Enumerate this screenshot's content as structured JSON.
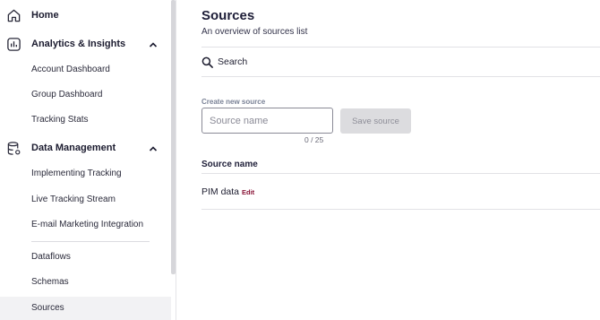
{
  "sidebar": {
    "home": {
      "label": "Home",
      "icon": "home-icon"
    },
    "analytics": {
      "label": "Analytics & Insights",
      "icon": "analytics-icon",
      "expanded": true,
      "items": [
        {
          "label": "Account Dashboard"
        },
        {
          "label": "Group Dashboard"
        },
        {
          "label": "Tracking Stats"
        }
      ]
    },
    "data_management": {
      "label": "Data Management",
      "icon": "database-icon",
      "expanded": true,
      "items": [
        {
          "label": "Implementing Tracking"
        },
        {
          "label": "Live Tracking Stream"
        },
        {
          "label": "E-mail Marketing Integration"
        },
        {
          "label": "Dataflows"
        },
        {
          "label": "Schemas"
        },
        {
          "label": "Sources",
          "active": true
        }
      ]
    }
  },
  "main": {
    "title": "Sources",
    "subtitle": "An overview of sources list",
    "search": {
      "label": "Search",
      "icon": "search-icon"
    },
    "create": {
      "label": "Create new source",
      "placeholder": "Source name",
      "value": "",
      "char_count": "0 / 25",
      "save_label": "Save source"
    },
    "table": {
      "header": "Source name",
      "rows": [
        {
          "name": "PIM data",
          "edit_label": "Edit"
        }
      ]
    }
  },
  "colors": {
    "accent_edit": "#8a1538",
    "title": "#1e1e38",
    "disabled_button_bg": "#dcdcdf",
    "active_item_bg": "#f2f2f4"
  }
}
